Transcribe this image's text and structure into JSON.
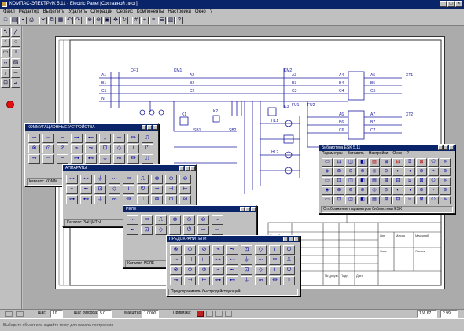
{
  "window": {
    "title": "КОМПАС-ЭЛЕКТРИК 5.11 - Electric Panel [Составной лист]"
  },
  "menu": [
    "Файл",
    "Редактор",
    "Выделить",
    "Удалить",
    "Операции",
    "Сервис",
    "Компоненты",
    "Настройки",
    "Окно",
    "?"
  ],
  "toolbar_icons": [
    "new-icon",
    "open-icon",
    "save-icon",
    "print-icon",
    "cut-icon",
    "copy-icon",
    "paste-icon",
    "undo-icon",
    "redo-icon",
    "zoom-in-icon",
    "zoom-out-icon",
    "zoom-window-icon",
    "pan-icon",
    "refresh-icon",
    "grid-icon",
    "snap-icon",
    "layers-icon",
    "properties-icon",
    "library-icon",
    "help-icon"
  ],
  "palettes": [
    {
      "title": "КОММУТАЦИОННЫЕ УСТРОЙСТВА",
      "footer": "Каталог: КОММ"
    },
    {
      "title": "АППАРАТЫ",
      "footer": "Каталог: ЗАЩИТЫ"
    },
    {
      "title": "РЕЛЕ",
      "footer": "Каталог: РЕЛЕ"
    },
    {
      "title": "ПРЕДОХРАНИТЕЛИ",
      "footer": "Предохранитель быстродействующий"
    }
  ],
  "library": {
    "title": "Библиотека ESK 5.11",
    "menu": [
      "Параметры",
      "Вставить",
      "Настройки",
      "Окно",
      "?"
    ],
    "footer": "Отображение параметров библиотеки ESK"
  },
  "drawing": {
    "labels": [
      "QF1",
      "A1",
      "B1",
      "C1",
      "N",
      "KM1",
      "A2",
      "B2",
      "C2",
      "KM2",
      "A3",
      "B3",
      "C3",
      "A4",
      "B4",
      "C4",
      "A5",
      "B5",
      "C5",
      "A6",
      "B6",
      "C6",
      "A7",
      "B7",
      "C7",
      "K1",
      "K2",
      "K3",
      "SB1",
      "SB2",
      "HL1",
      "HL2",
      "FU1",
      "FU2",
      "XT1",
      "XT2"
    ],
    "title_block": {
      "cells": [
        "Изм",
        "Лист",
        "№ докум.",
        "Подп.",
        "Дата",
        "Разраб.",
        "Пров.",
        "Лит.",
        "Масса",
        "Масштаб",
        "Лист",
        "Листов"
      ]
    }
  },
  "status": {
    "step_label": "Шаг:",
    "step_value": "10",
    "ortho_label": "Шаг курсора:",
    "ortho_value": "5.0",
    "scale_label": "Масштаб:",
    "scale_value": "1.0000",
    "angle_label": "Привязка:",
    "coords": "166.67",
    "coord2": "2.99"
  },
  "hint": "Выберите объект или задайте точку для начала построения"
}
